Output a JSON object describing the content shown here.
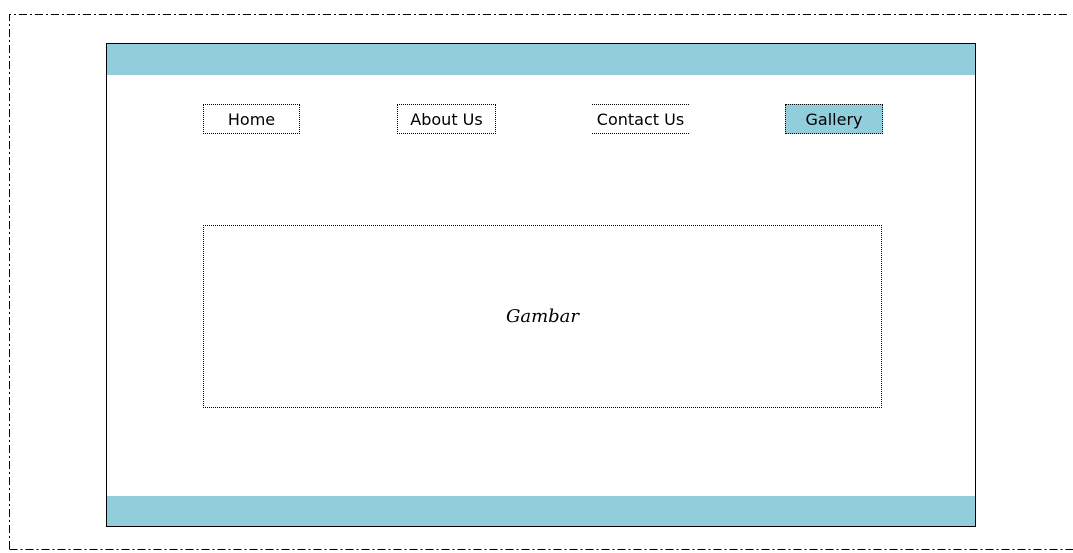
{
  "nav": {
    "items": [
      {
        "label": "Home",
        "active": false
      },
      {
        "label": "About Us",
        "active": false
      },
      {
        "label": "Contact Us",
        "active": false
      },
      {
        "label": "Gallery",
        "active": true
      }
    ]
  },
  "main": {
    "image_placeholder_label": "Gambar"
  },
  "colors": {
    "accent": "#92cddc",
    "border": "#000000",
    "background": "#ffffff"
  }
}
